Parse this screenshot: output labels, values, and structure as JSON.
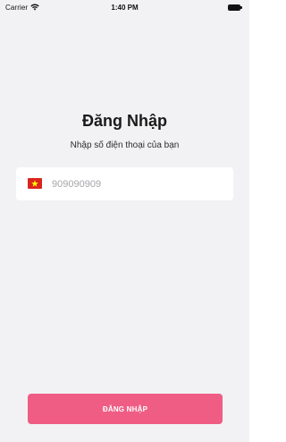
{
  "status_bar": {
    "carrier": "Carrier",
    "wifi_icon": "wifi-icon",
    "time": "1:40 PM",
    "battery_icon": "battery-icon"
  },
  "login": {
    "title": "Đăng Nhập",
    "subtitle": "Nhập số điện thoại của bạn",
    "phone_field": {
      "country_flag_icon": "vietnam-flag-icon",
      "value": "",
      "placeholder": "909090909"
    },
    "submit_label": "ĐĂNG NHẬP"
  },
  "colors": {
    "background": "#f2f2f4",
    "field_background": "#ffffff",
    "accent": "#ef5d84",
    "flag_red": "#da251d",
    "flag_star": "#ffff00"
  }
}
